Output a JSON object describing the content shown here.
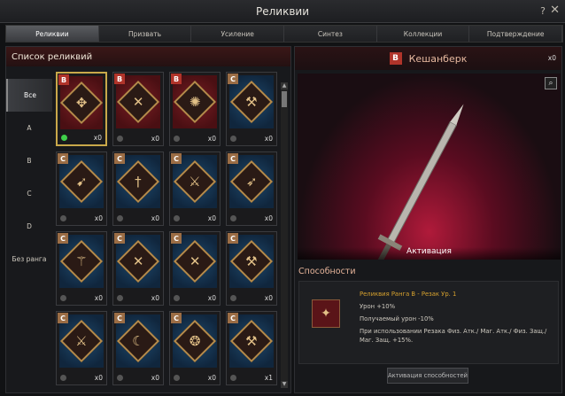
{
  "window": {
    "title": "Реликвии",
    "help": "?",
    "close": "✕"
  },
  "tabs": [
    "Реликвии",
    "Призвать",
    "Усиление",
    "Синтез",
    "Коллекции",
    "Подтверждение"
  ],
  "left": {
    "header": "Список реликвий",
    "filters": [
      "Все",
      "A",
      "B",
      "C",
      "D",
      "Без ранга"
    ]
  },
  "cards": [
    {
      "rank": "B",
      "glyph": "✥",
      "count": "x0",
      "selected": true,
      "gem": "green"
    },
    {
      "rank": "B",
      "glyph": "✕",
      "count": "x0"
    },
    {
      "rank": "B",
      "glyph": "✺",
      "count": "x0"
    },
    {
      "rank": "C",
      "glyph": "⚒",
      "count": "x0"
    },
    {
      "rank": "C",
      "glyph": "➹",
      "count": "x0"
    },
    {
      "rank": "C",
      "glyph": "†",
      "count": "x0"
    },
    {
      "rank": "C",
      "glyph": "⚔",
      "count": "x0"
    },
    {
      "rank": "C",
      "glyph": "➶",
      "count": "x0"
    },
    {
      "rank": "C",
      "glyph": "⚚",
      "count": "x0"
    },
    {
      "rank": "C",
      "glyph": "✕",
      "count": "x0"
    },
    {
      "rank": "C",
      "glyph": "✕",
      "count": "x0"
    },
    {
      "rank": "C",
      "glyph": "⚒",
      "count": "x0"
    },
    {
      "rank": "C",
      "glyph": "⚔",
      "count": "x0"
    },
    {
      "rank": "C",
      "glyph": "☾",
      "count": "x0"
    },
    {
      "rank": "C",
      "glyph": "❂",
      "count": "x0"
    },
    {
      "rank": "C",
      "glyph": "⚒",
      "count": "x1"
    }
  ],
  "detail": {
    "rank": "B",
    "name": "Кешанберк",
    "owned": "x0",
    "activation_caption": "Активация",
    "abilities_title": "Способности",
    "ability_lines": [
      "Реликвия Ранга B - Резак Ур. 1",
      "Урон +10%",
      "Получаемый урон -10%",
      "При использовании Резака Физ. Атк./ Маг. Атк./ Физ. Защ./ Маг. Защ. +15%."
    ],
    "activate_button": "Активация способностей"
  },
  "colors": {
    "rank_b": "#b0342a",
    "rank_c": "#9b6d45",
    "highlight": "#d6a12e"
  }
}
